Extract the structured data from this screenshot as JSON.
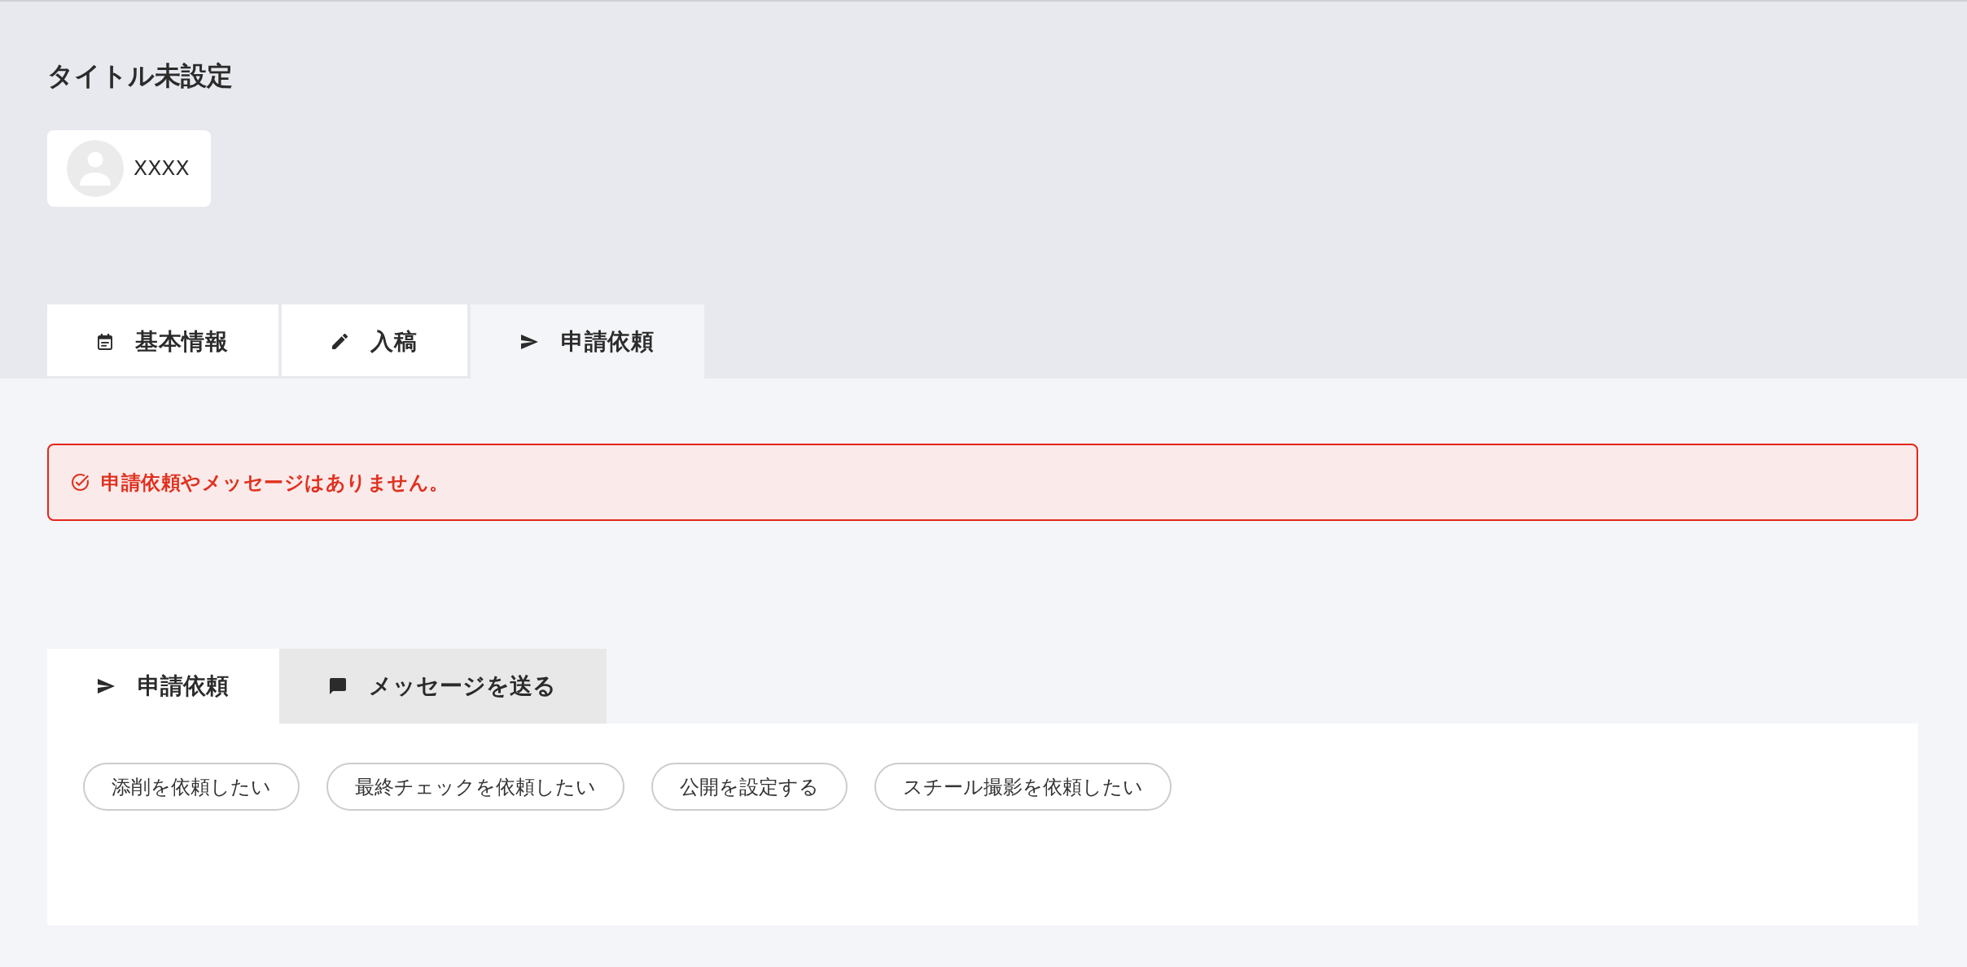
{
  "header": {
    "title": "タイトル未設定",
    "user": {
      "name": "XXXX"
    }
  },
  "tabs": [
    {
      "label": "基本情報",
      "selected": false
    },
    {
      "label": "入稿",
      "selected": false
    },
    {
      "label": "申請依頼",
      "selected": true
    }
  ],
  "alert": {
    "message": "申請依頼やメッセージはありません。"
  },
  "request_panel": {
    "tabs": [
      {
        "label": "申請依頼",
        "selected": true
      },
      {
        "label": "メッセージを送る",
        "selected": false
      }
    ],
    "actions": [
      "添削を依頼したい",
      "最終チェックを依頼したい",
      "公開を設定する",
      "スチール撮影を依頼したい"
    ]
  }
}
